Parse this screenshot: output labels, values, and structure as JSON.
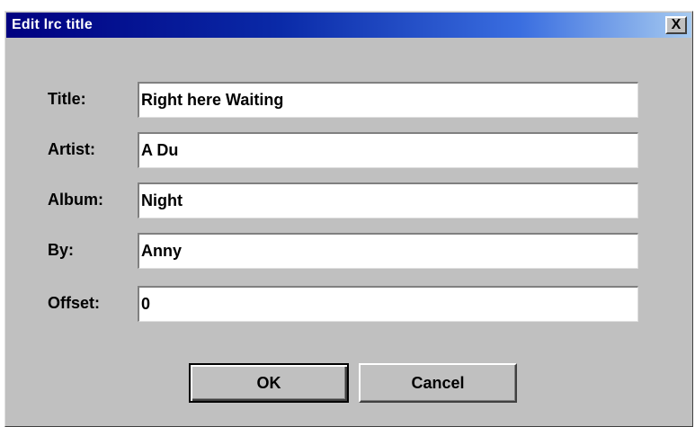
{
  "window": {
    "title": "Edit lrc title",
    "close_label": "X"
  },
  "form": {
    "fields": [
      {
        "label": "Title:",
        "value": "Right here Waiting"
      },
      {
        "label": "Artist:",
        "value": "A Du"
      },
      {
        "label": "Album:",
        "value": "Night"
      },
      {
        "label": "By:",
        "value": "Anny"
      },
      {
        "label": "Offset:",
        "value": "0"
      }
    ]
  },
  "buttons": {
    "ok_label": "OK",
    "cancel_label": "Cancel"
  }
}
